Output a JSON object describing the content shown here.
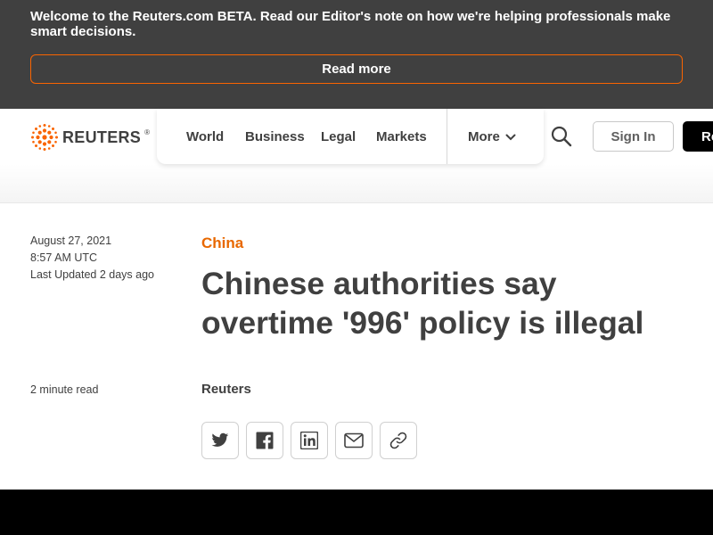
{
  "banner": {
    "message": "Welcome to the Reuters.com BETA. Read our Editor's note on how we're helping professionals make smart decisions.",
    "read_more_label": "Read more"
  },
  "header": {
    "logo_text": "REUTERS",
    "logo_mark": "®",
    "nav": [
      "World",
      "Business",
      "Legal",
      "Markets"
    ],
    "more_label": "More",
    "sign_in_label": "Sign In",
    "register_label": "Register"
  },
  "article": {
    "date": "August 27, 2021",
    "time": "8:57 AM UTC",
    "last_updated": "Last Updated 2 days ago",
    "category": "China",
    "headline": "Chinese authorities say overtime '996' policy is illegal",
    "read_time": "2 minute read",
    "author": "Reuters",
    "share_icons": [
      "twitter-icon",
      "facebook-icon",
      "linkedin-icon",
      "email-icon",
      "link-icon"
    ]
  },
  "colors": {
    "banner_bg": "#404040",
    "accent": "#fa6400",
    "text": "#404040"
  }
}
